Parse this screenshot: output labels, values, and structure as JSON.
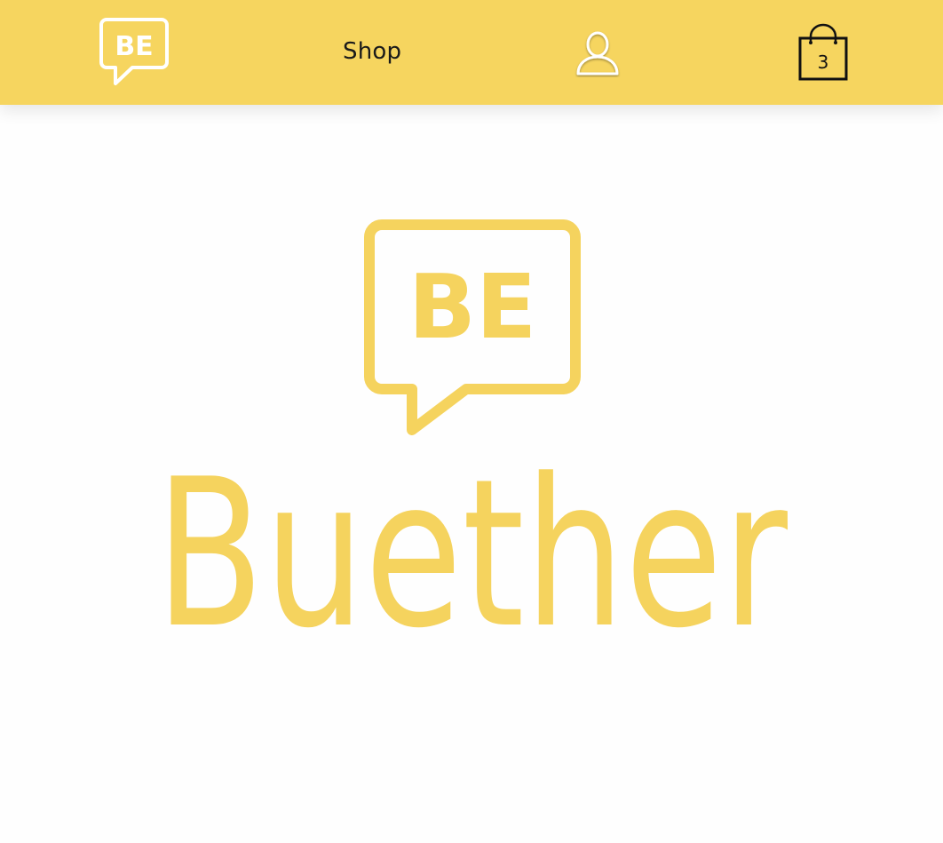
{
  "header": {
    "logo_text": "BE",
    "nav_shop": "Shop",
    "cart_count": "3",
    "icons": [
      "be-logo-icon",
      "user-icon",
      "shopping-bag-icon"
    ]
  },
  "hero": {
    "logo_mark_text": "BE",
    "brand_name": "Buether"
  },
  "colors": {
    "brand_yellow": "#f6d55f",
    "logo_yellow": "#f5d35e",
    "text_dark": "#1a1a1a",
    "background": "#fefefe"
  }
}
